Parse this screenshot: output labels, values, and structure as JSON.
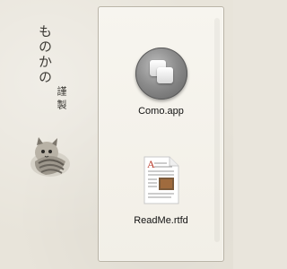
{
  "branding": {
    "title": "ものかの",
    "subtitle": "謹製"
  },
  "window": {
    "items": [
      {
        "label": "Como.app",
        "icon": "app-icon"
      },
      {
        "label": "ReadMe.rtfd",
        "icon": "rich-text-document-icon"
      }
    ]
  },
  "colors": {
    "background": "#e8e4da",
    "pane": "#f4f1ea"
  }
}
